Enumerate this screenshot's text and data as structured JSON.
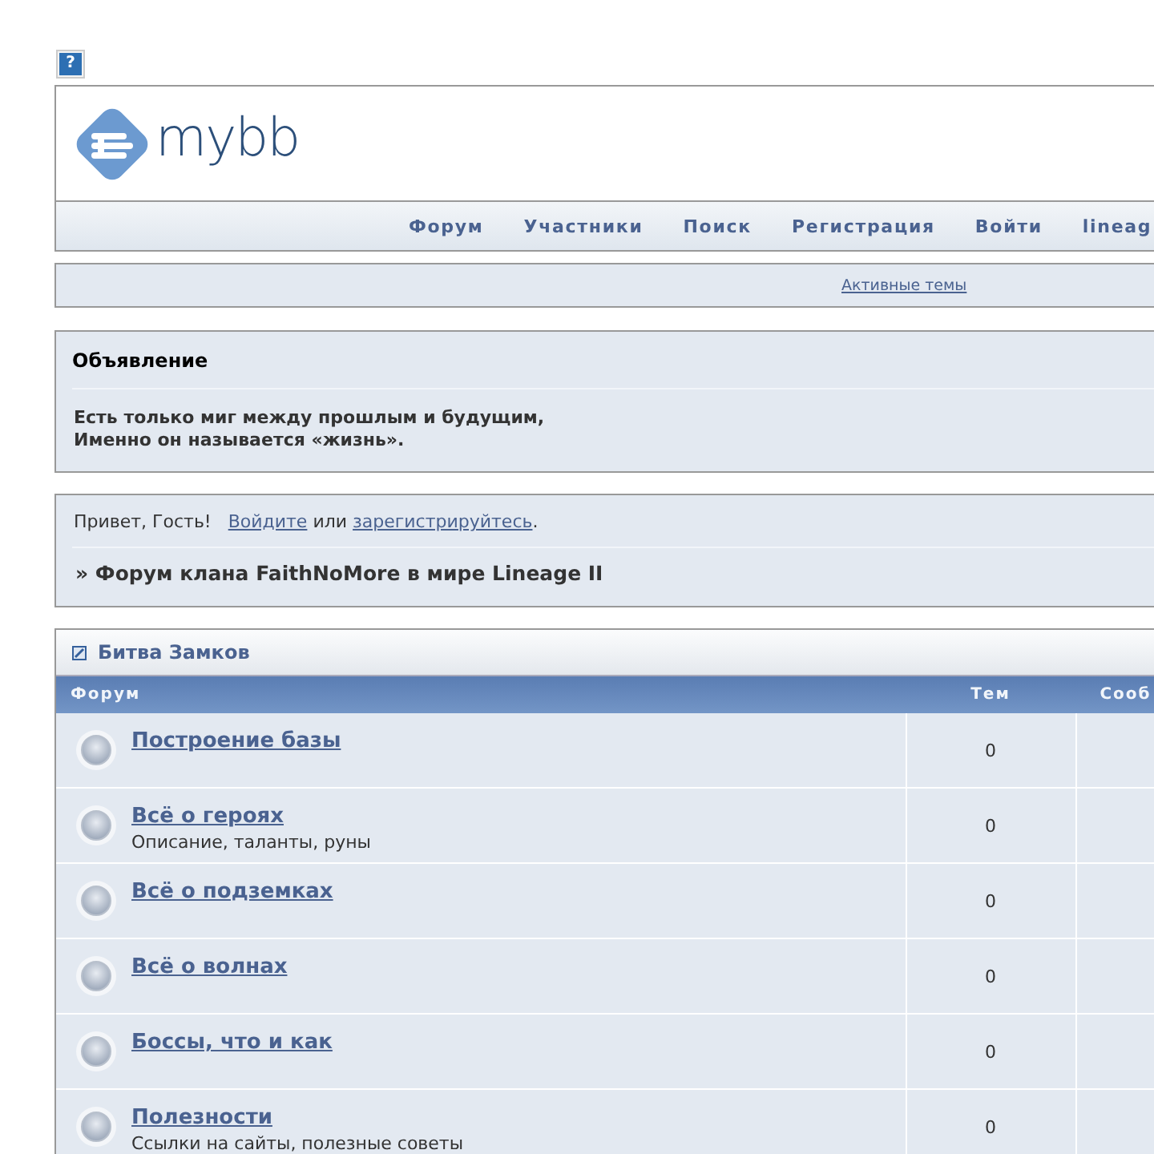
{
  "help_button": {
    "label": "?"
  },
  "header": {
    "logo_text": "mybb"
  },
  "nav": [
    {
      "label": "Форум"
    },
    {
      "label": "Участники"
    },
    {
      "label": "Поиск"
    },
    {
      "label": "Регистрация"
    },
    {
      "label": "Войти"
    },
    {
      "label": "lineag"
    }
  ],
  "quick_links": [
    {
      "label": "Активные темы"
    }
  ],
  "announcement": {
    "title": "Объявление",
    "text": "Есть только миг между прошлым и будущим,\nИменно он называется «жизнь»."
  },
  "welcome": {
    "greeting": "Привет, Гость!",
    "login_link": "Войдите",
    "or_word": "или",
    "register_link": "зарегистрируйтесь",
    "end": ".",
    "breadcrumb": "» Форум клана FaithNoMore в мире Lineage II"
  },
  "category": {
    "title": "Битва Замков",
    "columns": [
      {
        "label": "Форум"
      },
      {
        "label": "Тем"
      },
      {
        "label": "Сооб"
      }
    ],
    "forums": [
      {
        "name": "Построение базы",
        "threads": "0"
      },
      {
        "name": "Всё о героях",
        "description": "Описание, таланты, руны",
        "threads": "0"
      },
      {
        "name": "Всё о подземках",
        "threads": "0"
      },
      {
        "name": "Всё о волнах",
        "threads": "0"
      },
      {
        "name": "Боссы, что и как",
        "threads": "0"
      },
      {
        "name": "Полезности",
        "description": "Ссылки на сайты, полезные советы",
        "threads": "0"
      }
    ]
  }
}
